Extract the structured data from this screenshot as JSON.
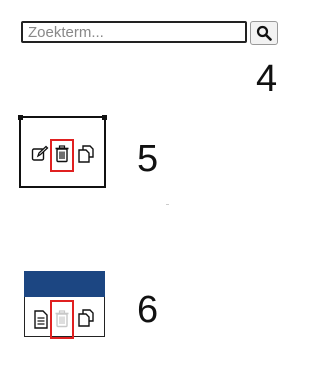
{
  "search": {
    "placeholder": "Zoekterm..."
  },
  "labels": {
    "n4": "4",
    "n5": "5",
    "n6": "6"
  },
  "icons": {
    "edit": "edit-icon",
    "delete": "trash-icon",
    "copy": "copy-icon",
    "document": "document-icon",
    "search": "search-icon"
  },
  "colors": {
    "highlight": "#e02020",
    "header": "#1c4682"
  }
}
